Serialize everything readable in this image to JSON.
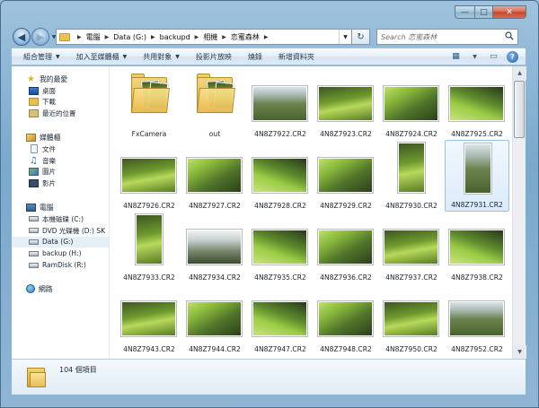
{
  "window": {
    "caption_buttons": {
      "minimize": "—",
      "maximize": "□",
      "close": "✕"
    }
  },
  "address_bar": {
    "crumbs": [
      "電腦",
      "Data (G:)",
      "backupd",
      "相機",
      "恋蜜森林"
    ],
    "refresh_glyph": "↻"
  },
  "search": {
    "placeholder": "Search 恋蜜森林"
  },
  "toolbar": {
    "organize": "組合管理",
    "add_to_library": "加入至媒體櫃",
    "share_with": "共用對象",
    "slideshow": "投影片放映",
    "burn": "燒錄",
    "new_folder": "新增資料夾",
    "help": "?"
  },
  "nav_pane": {
    "favorites": {
      "title": "我的最愛",
      "items": [
        "桌面",
        "下載",
        "最近的位置"
      ]
    },
    "libraries": {
      "title": "媒體櫃",
      "items": [
        "文件",
        "音樂",
        "圖片",
        "影片"
      ]
    },
    "computer": {
      "title": "電腦",
      "items": [
        "本機磁碟 (C:)",
        "DVD 光碟機 (D:) SK",
        "Data (G:)",
        "backup (H:)",
        "RamDisk (R:)"
      ],
      "selected_index": 2
    },
    "network": {
      "title": "網路"
    }
  },
  "files": [
    {
      "name": "FxCamera",
      "kind": "folder"
    },
    {
      "name": "out",
      "kind": "folder"
    },
    {
      "name": "4N8Z7922.CR2",
      "kind": "landscape",
      "tone": "t-c"
    },
    {
      "name": "4N8Z7923.CR2",
      "kind": "landscape",
      "tone": "t-a"
    },
    {
      "name": "4N8Z7924.CR2",
      "kind": "landscape",
      "tone": "t-b"
    },
    {
      "name": "4N8Z7925.CR2",
      "kind": "landscape",
      "tone": "t-d"
    },
    {
      "name": "4N8Z7926.CR2",
      "kind": "landscape",
      "tone": "t-a"
    },
    {
      "name": "4N8Z7927.CR2",
      "kind": "landscape",
      "tone": "t-b"
    },
    {
      "name": "4N8Z7928.CR2",
      "kind": "landscape",
      "tone": "t-d"
    },
    {
      "name": "4N8Z7929.CR2",
      "kind": "landscape",
      "tone": "t-b"
    },
    {
      "name": "4N8Z7930.CR2",
      "kind": "portrait",
      "tone": "t-a"
    },
    {
      "name": "4N8Z7931.CR2",
      "kind": "portrait",
      "tone": "t-c",
      "selected": true
    },
    {
      "name": "4N8Z7933.CR2",
      "kind": "portrait",
      "tone": "t-a"
    },
    {
      "name": "4N8Z7934.CR2",
      "kind": "landscape",
      "tone": "t-e"
    },
    {
      "name": "4N8Z7935.CR2",
      "kind": "landscape",
      "tone": "t-d"
    },
    {
      "name": "4N8Z7936.CR2",
      "kind": "landscape",
      "tone": "t-b"
    },
    {
      "name": "4N8Z7937.CR2",
      "kind": "landscape",
      "tone": "t-a"
    },
    {
      "name": "4N8Z7938.CR2",
      "kind": "landscape",
      "tone": "t-d"
    },
    {
      "name": "4N8Z7943.CR2",
      "kind": "landscape",
      "tone": "t-a"
    },
    {
      "name": "4N8Z7944.CR2",
      "kind": "landscape",
      "tone": "t-b"
    },
    {
      "name": "4N8Z7947.CR2",
      "kind": "landscape",
      "tone": "t-d"
    },
    {
      "name": "4N8Z7948.CR2",
      "kind": "landscape",
      "tone": "t-b"
    },
    {
      "name": "4N8Z7950.CR2",
      "kind": "landscape",
      "tone": "t-a"
    },
    {
      "name": "4N8Z7952.CR2",
      "kind": "landscape",
      "tone": "t-c"
    },
    {
      "name": "",
      "kind": "landscape",
      "tone": "t-a"
    },
    {
      "name": "",
      "kind": "landscape",
      "tone": "t-b"
    },
    {
      "name": "",
      "kind": "landscape",
      "tone": "t-e"
    },
    {
      "name": "",
      "kind": "landscape",
      "tone": "t-e"
    },
    {
      "name": "",
      "kind": "landscape",
      "tone": "t-c"
    },
    {
      "name": "",
      "kind": "landscape",
      "tone": "t-e"
    }
  ],
  "details_pane": {
    "count_text": "104 個項目"
  }
}
